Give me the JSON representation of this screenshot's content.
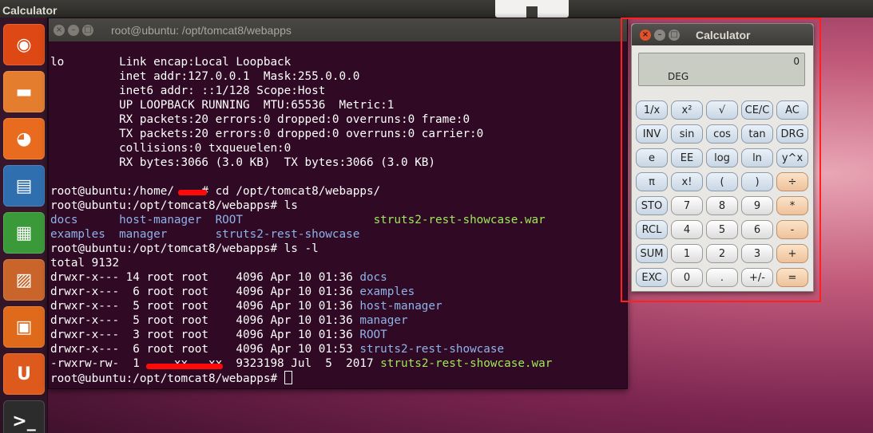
{
  "top_panel": {
    "app_title": "Calculator"
  },
  "launcher": {
    "items": [
      {
        "name": "dash-icon",
        "glyph": "◉",
        "color": "#dd4814"
      },
      {
        "name": "files-icon",
        "glyph": "▬",
        "color": "#e57d2f"
      },
      {
        "name": "firefox-icon",
        "glyph": "◕",
        "color": "#e96b1f"
      },
      {
        "name": "writer-icon",
        "glyph": "▤",
        "color": "#2f6fb0"
      },
      {
        "name": "calc-spreadsheet-icon",
        "glyph": "▦",
        "color": "#3a9a3a"
      },
      {
        "name": "impress-icon",
        "glyph": "▨",
        "color": "#c9652a"
      },
      {
        "name": "software-center-icon",
        "glyph": "▣",
        "color": "#e06a1c"
      },
      {
        "name": "ubuntu-one-icon",
        "glyph": "U",
        "color": "#dd5a1c"
      },
      {
        "name": "terminal-icon",
        "glyph": ">_",
        "color": "#2c2c2c"
      }
    ]
  },
  "terminal": {
    "title": "root@ubuntu: /opt/tomcat8/webapps",
    "lines": [
      {
        "segments": [
          {
            "text": "lo        Link encap:Local Loopback"
          }
        ]
      },
      {
        "segments": [
          {
            "text": "          inet addr:127.0.0.1  Mask:255.0.0.0"
          }
        ]
      },
      {
        "segments": [
          {
            "text": "          inet6 addr: ::1/128 Scope:Host"
          }
        ]
      },
      {
        "segments": [
          {
            "text": "          UP LOOPBACK RUNNING  MTU:65536  Metric:1"
          }
        ]
      },
      {
        "segments": [
          {
            "text": "          RX packets:20 errors:0 dropped:0 overruns:0 frame:0"
          }
        ]
      },
      {
        "segments": [
          {
            "text": "          TX packets:20 errors:0 dropped:0 overruns:0 carrier:0"
          }
        ]
      },
      {
        "segments": [
          {
            "text": "          collisions:0 txqueuelen:0"
          }
        ]
      },
      {
        "segments": [
          {
            "text": "          RX bytes:3066 (3.0 KB)  TX bytes:3066 (3.0 KB)"
          }
        ]
      },
      {
        "segments": [
          {
            "text": ""
          }
        ]
      },
      {
        "segments": [
          {
            "text": "root@ubuntu:/home/    # cd /opt/tomcat8/webapps/"
          }
        ],
        "redact": true
      },
      {
        "segments": [
          {
            "text": "root@ubuntu:/opt/tomcat8/webapps# ls"
          }
        ]
      },
      {
        "segments": [
          {
            "text": "docs      host-manager  ROOT                   ",
            "cls": "blue"
          },
          {
            "text": "struts2-rest-showcase.war",
            "cls": "green"
          }
        ]
      },
      {
        "segments": [
          {
            "text": "examples  manager       struts2-rest-showcase",
            "cls": "blue"
          }
        ]
      },
      {
        "segments": [
          {
            "text": "root@ubuntu:/opt/tomcat8/webapps# ls -l"
          }
        ]
      },
      {
        "segments": [
          {
            "text": "total 9132"
          }
        ]
      },
      {
        "segments": [
          {
            "text": "drwxr-x--- 14 root root    4096 Apr 10 01:36 "
          },
          {
            "text": "docs",
            "cls": "blue"
          }
        ]
      },
      {
        "segments": [
          {
            "text": "drwxr-x---  6 root root    4096 Apr 10 01:36 "
          },
          {
            "text": "examples",
            "cls": "blue"
          }
        ]
      },
      {
        "segments": [
          {
            "text": "drwxr-x---  5 root root    4096 Apr 10 01:36 "
          },
          {
            "text": "host-manager",
            "cls": "blue"
          }
        ]
      },
      {
        "segments": [
          {
            "text": "drwxr-x---  5 root root    4096 Apr 10 01:36 "
          },
          {
            "text": "manager",
            "cls": "blue"
          }
        ]
      },
      {
        "segments": [
          {
            "text": "drwxr-x---  3 root root    4096 Apr 10 01:36 "
          },
          {
            "text": "ROOT",
            "cls": "blue"
          }
        ]
      },
      {
        "segments": [
          {
            "text": "drwxr-x---  6 root root    4096 Apr 10 01:53 "
          },
          {
            "text": "struts2-rest-showcase",
            "cls": "blue"
          }
        ]
      },
      {
        "segments": [
          {
            "text": "-rwxrw-rw-  1     xx   xx  9323198 Jul  5  2017 "
          },
          {
            "text": "struts2-rest-showcase.war",
            "cls": "green"
          }
        ],
        "redact": true
      },
      {
        "segments": [
          {
            "text": "root@ubuntu:/opt/tomcat8/webapps# "
          }
        ],
        "cursor": true
      }
    ]
  },
  "calculator": {
    "title": "Calculator",
    "display_value": "0",
    "angle_mode": "DEG",
    "keys": [
      [
        "1/x",
        "x²",
        "√",
        "CE/C",
        "AC"
      ],
      [
        "INV",
        "sin",
        "cos",
        "tan",
        "DRG"
      ],
      [
        "e",
        "EE",
        "log",
        "ln",
        "y^x"
      ],
      [
        "π",
        "x!",
        "(",
        ")",
        "÷"
      ],
      [
        "STO",
        "7",
        "8",
        "9",
        "*"
      ],
      [
        "RCL",
        "4",
        "5",
        "6",
        "-"
      ],
      [
        "SUM",
        "1",
        "2",
        "3",
        "+"
      ],
      [
        "EXC",
        "0",
        ".",
        "+/-",
        "="
      ]
    ]
  }
}
